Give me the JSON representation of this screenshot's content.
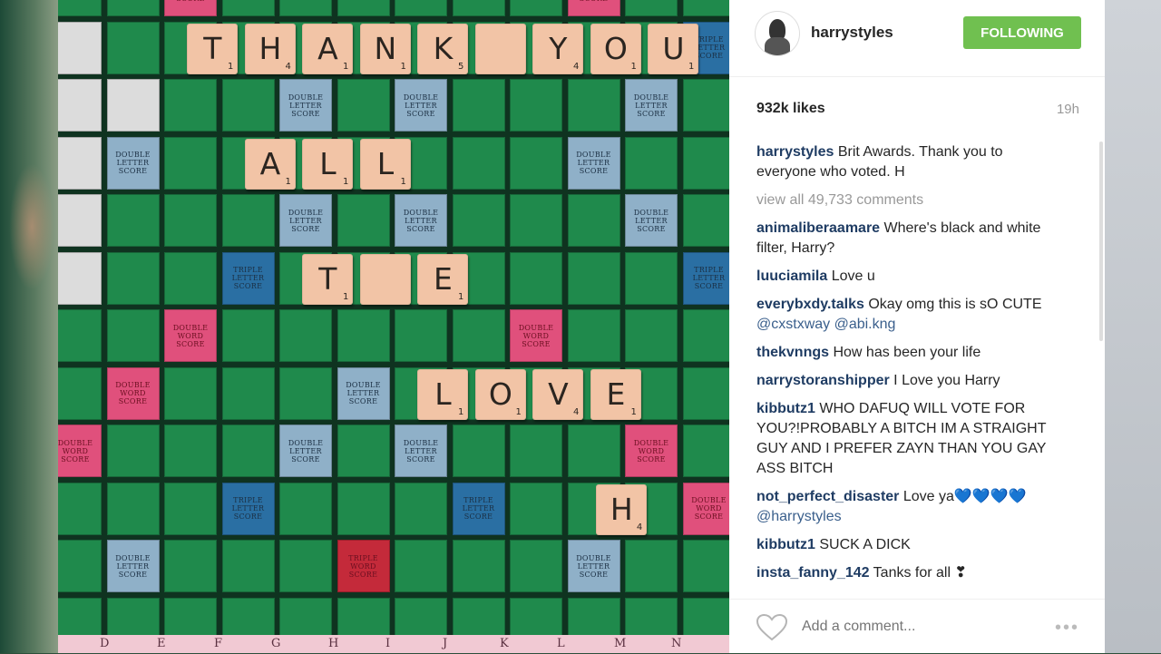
{
  "post": {
    "username": "harrystyles",
    "follow_label": "FOLLOWING",
    "likes": "932k likes",
    "time_ago": "19h",
    "caption_user": "harrystyles",
    "caption_text": "Brit Awards. Thank you to everyone who voted. H",
    "view_all": "view all 49,733 comments",
    "comment_placeholder": "Add a comment...",
    "more_label": "•••"
  },
  "comments": [
    {
      "user": "animaliberaamare",
      "text": "Where's black and white filter, Harry?"
    },
    {
      "user": "luuciamila",
      "text": "Love u"
    },
    {
      "user": "everybxdy.talks",
      "text": "Okay omg this is sO CUTE",
      "mentions": "@cxstxway @abi.kng"
    },
    {
      "user": "thekvnngs",
      "text": "How has been your life"
    },
    {
      "user": "narrystoranshipper",
      "text": "I Love you Harry"
    },
    {
      "user": "kibbutz1",
      "text": "WHO DAFUQ WILL VOTE FOR YOU?!PROBABLY A BITCH IM A STRAIGHT GUY AND I PREFER ZAYN THAN YOU GAY ASS BITCH"
    },
    {
      "user": "not_perfect_disaster",
      "text": "Love ya💙💙💙💙",
      "mentions": "@harrystyles"
    },
    {
      "user": "kibbutz1",
      "text": "SUCK A DICK"
    },
    {
      "user": "insta_fanny_142",
      "text": "Tanks for all ❣"
    }
  ],
  "board": {
    "premium_labels": {
      "dl": "DOUBLE LETTER SCORE",
      "tl": "TRIPLE LETTER SCORE",
      "dw": "DOUBLE WORD SCORE",
      "tw": "TRIPLE WORD SCORE"
    },
    "words": [
      {
        "word": "THANK YOU",
        "letters": [
          {
            "l": "T",
            "v": "1"
          },
          {
            "l": "H",
            "v": "4"
          },
          {
            "l": "A",
            "v": "1"
          },
          {
            "l": "N",
            "v": "1"
          },
          {
            "l": "K",
            "v": "5"
          },
          {
            "l": "",
            "v": ""
          },
          {
            "l": "Y",
            "v": "4"
          },
          {
            "l": "O",
            "v": "1"
          },
          {
            "l": "U",
            "v": "1"
          }
        ]
      },
      {
        "word": "ALL",
        "letters": [
          {
            "l": "A",
            "v": "1"
          },
          {
            "l": "L",
            "v": "1"
          },
          {
            "l": "L",
            "v": "1"
          }
        ]
      },
      {
        "word": "THE",
        "letters": [
          {
            "l": "T",
            "v": "1"
          },
          {
            "l": "",
            "v": ""
          },
          {
            "l": "E",
            "v": "1"
          }
        ]
      },
      {
        "word": "LOVE",
        "letters": [
          {
            "l": "L",
            "v": "1"
          },
          {
            "l": "O",
            "v": "1"
          },
          {
            "l": "V",
            "v": "4"
          },
          {
            "l": "E",
            "v": "1"
          }
        ]
      },
      {
        "word": "H",
        "letters": [
          {
            "l": "H",
            "v": "4"
          }
        ]
      }
    ],
    "column_letters": [
      "D",
      "E",
      "F",
      "G",
      "H",
      "I",
      "J",
      "K",
      "L",
      "M",
      "N"
    ]
  },
  "colors": {
    "follow_green": "#70c050",
    "board_green": "#1f8a4c",
    "tile": "#f2c4a6",
    "username_blue": "#1f3c63"
  },
  "icons": [
    "heart-icon",
    "more-options-icon"
  ]
}
